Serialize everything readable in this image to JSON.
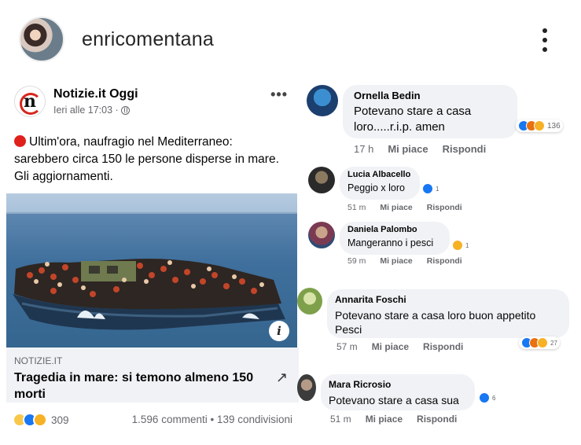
{
  "header": {
    "username": "enricomentana"
  },
  "post": {
    "page_name": "Notizie.it Oggi",
    "logo_letter": "n",
    "time": "Ieri alle 17:03 ·",
    "text": "Ultim'ora, naufragio nel Mediterraneo: sarebbero circa 150 le persone disperse in mare. Gli aggiornamenti.",
    "link": {
      "domain": "NOTIZIE.IT",
      "title": "Tragedia in mare: si temono almeno 150 morti"
    },
    "reactions_count": "309",
    "stats": "1.596 commenti • 139 condivisioni"
  },
  "comments": [
    {
      "name": "Ornella Bedin",
      "text": "Potevano stare a casa loro.....r.i.p. amen",
      "time": "17 h",
      "like": "Mi piace",
      "reply": "Rispondi",
      "reactions": "136"
    },
    {
      "name": "Lucia Albacello",
      "text": "Peggio x loro",
      "time": "51 m",
      "like": "Mi piace",
      "reply": "Rispondi",
      "reactions": "1"
    },
    {
      "name": "Daniela Palombo",
      "text": "Mangeranno i pesci",
      "time": "59 m",
      "like": "Mi piace",
      "reply": "Rispondi",
      "reactions": "1"
    },
    {
      "name": "Annarita Foschi",
      "text": "Potevano stare a casa  loro buon appetito Pesci",
      "time": "57 m",
      "like": "Mi piace",
      "reply": "Rispondi",
      "reactions": "27"
    },
    {
      "name": "Mara Ricrosio",
      "text": "Potevano stare a casa sua",
      "time": "51 m",
      "like": "Mi piace",
      "reply": "Rispondi",
      "reactions": "6"
    }
  ],
  "colors": {
    "accent": "#1877f2",
    "red_dot": "#e0201b",
    "bubble": "#f0f2f5"
  }
}
